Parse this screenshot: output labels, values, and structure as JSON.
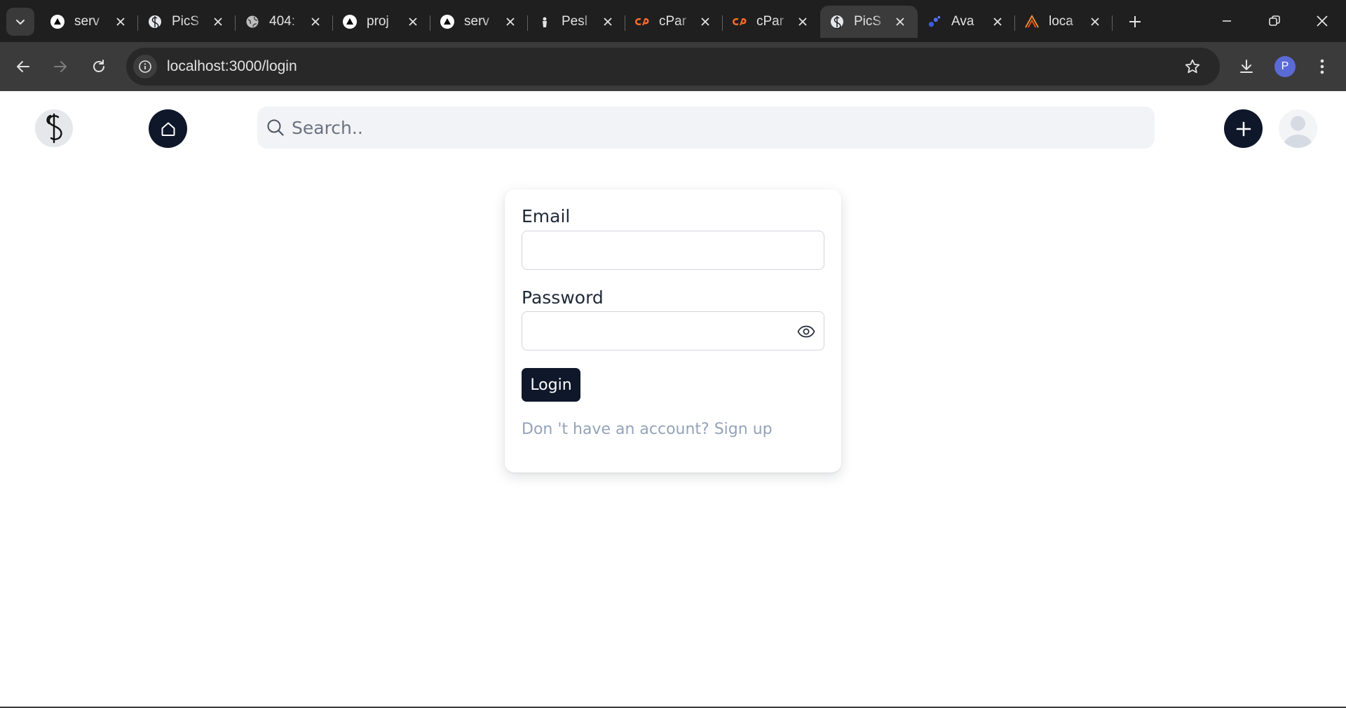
{
  "browser": {
    "tabs": [
      {
        "title": "serv",
        "icon": "triangle-icon",
        "active": false
      },
      {
        "title": "PicS",
        "icon": "picshare-icon",
        "active": false
      },
      {
        "title": "404:",
        "icon": "globe-icon",
        "active": false
      },
      {
        "title": "proj",
        "icon": "triangle-icon",
        "active": false
      },
      {
        "title": "serv",
        "icon": "triangle-icon",
        "active": false
      },
      {
        "title": "Pesl",
        "icon": "pesl-icon",
        "active": false
      },
      {
        "title": "cPar",
        "icon": "cpanel-icon",
        "active": false
      },
      {
        "title": "cPar",
        "icon": "cpanel-icon",
        "active": false
      },
      {
        "title": "PicS",
        "icon": "picshare-icon",
        "active": true
      },
      {
        "title": "Ava",
        "icon": "dots-icon",
        "active": false
      },
      {
        "title": "loca",
        "icon": "xampp-icon",
        "active": false
      }
    ],
    "address": {
      "host": "localhost",
      "path": ":3000/login"
    },
    "profile_initial": "P",
    "colors": {
      "cpanel": "#ff6c2c",
      "active_tab": "#3b3b3b",
      "frame": "#1f1f1f"
    }
  },
  "site": {
    "search_placeholder": "Search..",
    "colors": {
      "primary": "#0f172a",
      "muted": "#94a3b8",
      "search_bg": "#f1f3f6"
    }
  },
  "login": {
    "email_label": "Email",
    "email_value": "",
    "password_label": "Password",
    "password_value": "",
    "submit_label": "Login",
    "signup_prompt": "Don 't have an account?",
    "signup_link": "Sign up"
  }
}
